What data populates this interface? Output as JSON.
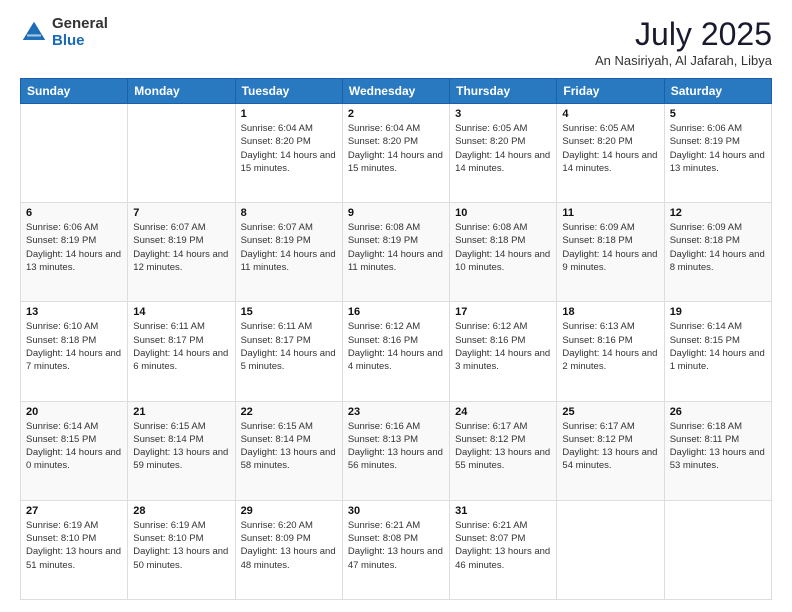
{
  "logo": {
    "general": "General",
    "blue": "Blue"
  },
  "title": "July 2025",
  "location": "An Nasiriyah, Al Jafarah, Libya",
  "days_of_week": [
    "Sunday",
    "Monday",
    "Tuesday",
    "Wednesday",
    "Thursday",
    "Friday",
    "Saturday"
  ],
  "weeks": [
    [
      {
        "day": "",
        "info": ""
      },
      {
        "day": "",
        "info": ""
      },
      {
        "day": "1",
        "info": "Sunrise: 6:04 AM\nSunset: 8:20 PM\nDaylight: 14 hours and 15 minutes."
      },
      {
        "day": "2",
        "info": "Sunrise: 6:04 AM\nSunset: 8:20 PM\nDaylight: 14 hours and 15 minutes."
      },
      {
        "day": "3",
        "info": "Sunrise: 6:05 AM\nSunset: 8:20 PM\nDaylight: 14 hours and 14 minutes."
      },
      {
        "day": "4",
        "info": "Sunrise: 6:05 AM\nSunset: 8:20 PM\nDaylight: 14 hours and 14 minutes."
      },
      {
        "day": "5",
        "info": "Sunrise: 6:06 AM\nSunset: 8:19 PM\nDaylight: 14 hours and 13 minutes."
      }
    ],
    [
      {
        "day": "6",
        "info": "Sunrise: 6:06 AM\nSunset: 8:19 PM\nDaylight: 14 hours and 13 minutes."
      },
      {
        "day": "7",
        "info": "Sunrise: 6:07 AM\nSunset: 8:19 PM\nDaylight: 14 hours and 12 minutes."
      },
      {
        "day": "8",
        "info": "Sunrise: 6:07 AM\nSunset: 8:19 PM\nDaylight: 14 hours and 11 minutes."
      },
      {
        "day": "9",
        "info": "Sunrise: 6:08 AM\nSunset: 8:19 PM\nDaylight: 14 hours and 11 minutes."
      },
      {
        "day": "10",
        "info": "Sunrise: 6:08 AM\nSunset: 8:18 PM\nDaylight: 14 hours and 10 minutes."
      },
      {
        "day": "11",
        "info": "Sunrise: 6:09 AM\nSunset: 8:18 PM\nDaylight: 14 hours and 9 minutes."
      },
      {
        "day": "12",
        "info": "Sunrise: 6:09 AM\nSunset: 8:18 PM\nDaylight: 14 hours and 8 minutes."
      }
    ],
    [
      {
        "day": "13",
        "info": "Sunrise: 6:10 AM\nSunset: 8:18 PM\nDaylight: 14 hours and 7 minutes."
      },
      {
        "day": "14",
        "info": "Sunrise: 6:11 AM\nSunset: 8:17 PM\nDaylight: 14 hours and 6 minutes."
      },
      {
        "day": "15",
        "info": "Sunrise: 6:11 AM\nSunset: 8:17 PM\nDaylight: 14 hours and 5 minutes."
      },
      {
        "day": "16",
        "info": "Sunrise: 6:12 AM\nSunset: 8:16 PM\nDaylight: 14 hours and 4 minutes."
      },
      {
        "day": "17",
        "info": "Sunrise: 6:12 AM\nSunset: 8:16 PM\nDaylight: 14 hours and 3 minutes."
      },
      {
        "day": "18",
        "info": "Sunrise: 6:13 AM\nSunset: 8:16 PM\nDaylight: 14 hours and 2 minutes."
      },
      {
        "day": "19",
        "info": "Sunrise: 6:14 AM\nSunset: 8:15 PM\nDaylight: 14 hours and 1 minute."
      }
    ],
    [
      {
        "day": "20",
        "info": "Sunrise: 6:14 AM\nSunset: 8:15 PM\nDaylight: 14 hours and 0 minutes."
      },
      {
        "day": "21",
        "info": "Sunrise: 6:15 AM\nSunset: 8:14 PM\nDaylight: 13 hours and 59 minutes."
      },
      {
        "day": "22",
        "info": "Sunrise: 6:15 AM\nSunset: 8:14 PM\nDaylight: 13 hours and 58 minutes."
      },
      {
        "day": "23",
        "info": "Sunrise: 6:16 AM\nSunset: 8:13 PM\nDaylight: 13 hours and 56 minutes."
      },
      {
        "day": "24",
        "info": "Sunrise: 6:17 AM\nSunset: 8:12 PM\nDaylight: 13 hours and 55 minutes."
      },
      {
        "day": "25",
        "info": "Sunrise: 6:17 AM\nSunset: 8:12 PM\nDaylight: 13 hours and 54 minutes."
      },
      {
        "day": "26",
        "info": "Sunrise: 6:18 AM\nSunset: 8:11 PM\nDaylight: 13 hours and 53 minutes."
      }
    ],
    [
      {
        "day": "27",
        "info": "Sunrise: 6:19 AM\nSunset: 8:10 PM\nDaylight: 13 hours and 51 minutes."
      },
      {
        "day": "28",
        "info": "Sunrise: 6:19 AM\nSunset: 8:10 PM\nDaylight: 13 hours and 50 minutes."
      },
      {
        "day": "29",
        "info": "Sunrise: 6:20 AM\nSunset: 8:09 PM\nDaylight: 13 hours and 48 minutes."
      },
      {
        "day": "30",
        "info": "Sunrise: 6:21 AM\nSunset: 8:08 PM\nDaylight: 13 hours and 47 minutes."
      },
      {
        "day": "31",
        "info": "Sunrise: 6:21 AM\nSunset: 8:07 PM\nDaylight: 13 hours and 46 minutes."
      },
      {
        "day": "",
        "info": ""
      },
      {
        "day": "",
        "info": ""
      }
    ]
  ]
}
